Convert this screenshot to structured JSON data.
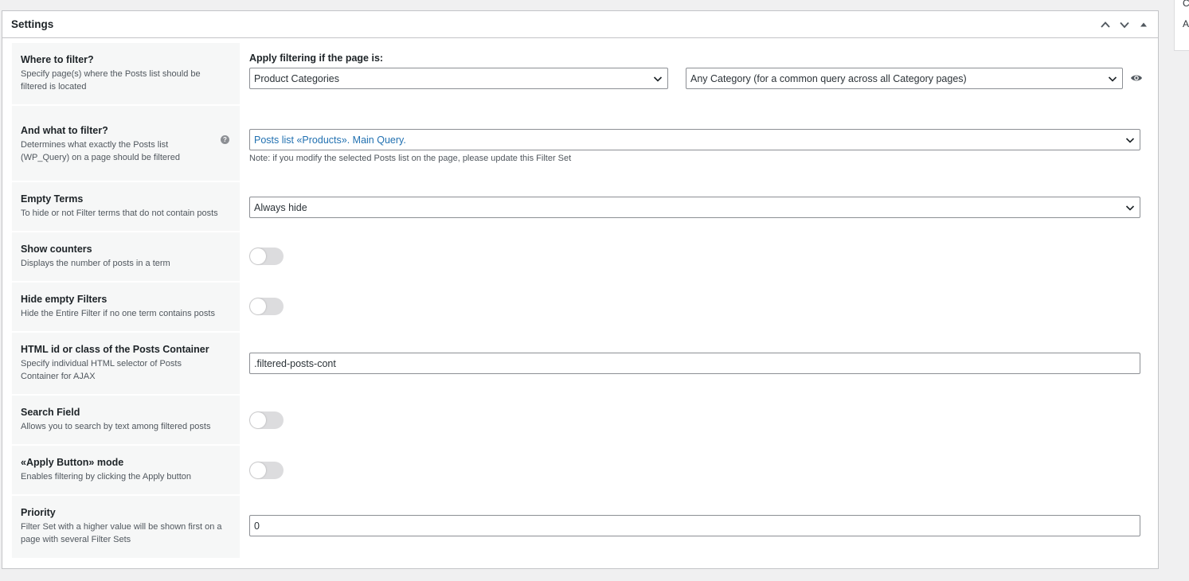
{
  "side_panel": {
    "line1": "C",
    "line2": "A"
  },
  "metabox": {
    "title": "Settings",
    "controls": {
      "move_up_icon": "chevron-up-icon",
      "move_down_icon": "chevron-down-icon",
      "toggle_icon": "triangle-up-icon"
    }
  },
  "rows": {
    "where": {
      "title": "Where to filter?",
      "desc": "Specify page(s) where the Posts list should be filtered is located",
      "caption": "Apply filtering if the page is:",
      "page_type_value": "Product Categories",
      "category_value": "Any Category (for a common query across all Category pages)",
      "preview_icon": "eye-icon"
    },
    "what": {
      "title": "And what to filter?",
      "desc": "Determines what exactly the Posts list (WP_Query) on a page should be filtered",
      "help_icon": "question-icon",
      "help_glyph": "?",
      "value": "Posts list «Products». Main Query.",
      "note": "Note: if you modify the selected Posts list on the page, please update this Filter Set"
    },
    "empty_terms": {
      "title": "Empty Terms",
      "desc": "To hide or not Filter terms that do not contain posts",
      "value": "Always hide"
    },
    "show_counters": {
      "title": "Show counters",
      "desc": "Displays the number of posts in a term",
      "enabled": false
    },
    "hide_empty_filters": {
      "title": "Hide empty Filters",
      "desc": "Hide the Entire Filter if no one term contains posts",
      "enabled": false
    },
    "container": {
      "title": "HTML id or class of the Posts Container",
      "desc": "Specify individual HTML selector of Posts Container for AJAX",
      "value": ".filtered-posts-cont"
    },
    "search_field": {
      "title": "Search Field",
      "desc": "Allows you to search by text among filtered posts",
      "enabled": false
    },
    "apply_button": {
      "title": "«Apply Button» mode",
      "desc": "Enables filtering by clicking the Apply button",
      "enabled": false
    },
    "priority": {
      "title": "Priority",
      "desc": "Filter Set with a higher value will be shown first on a page with several Filter Sets",
      "value": "0"
    }
  },
  "colors": {
    "link": "#2271b1",
    "toggle_off": "#dcdcde",
    "label_bg": "#f6f7f7",
    "border": "#8c8f94"
  }
}
